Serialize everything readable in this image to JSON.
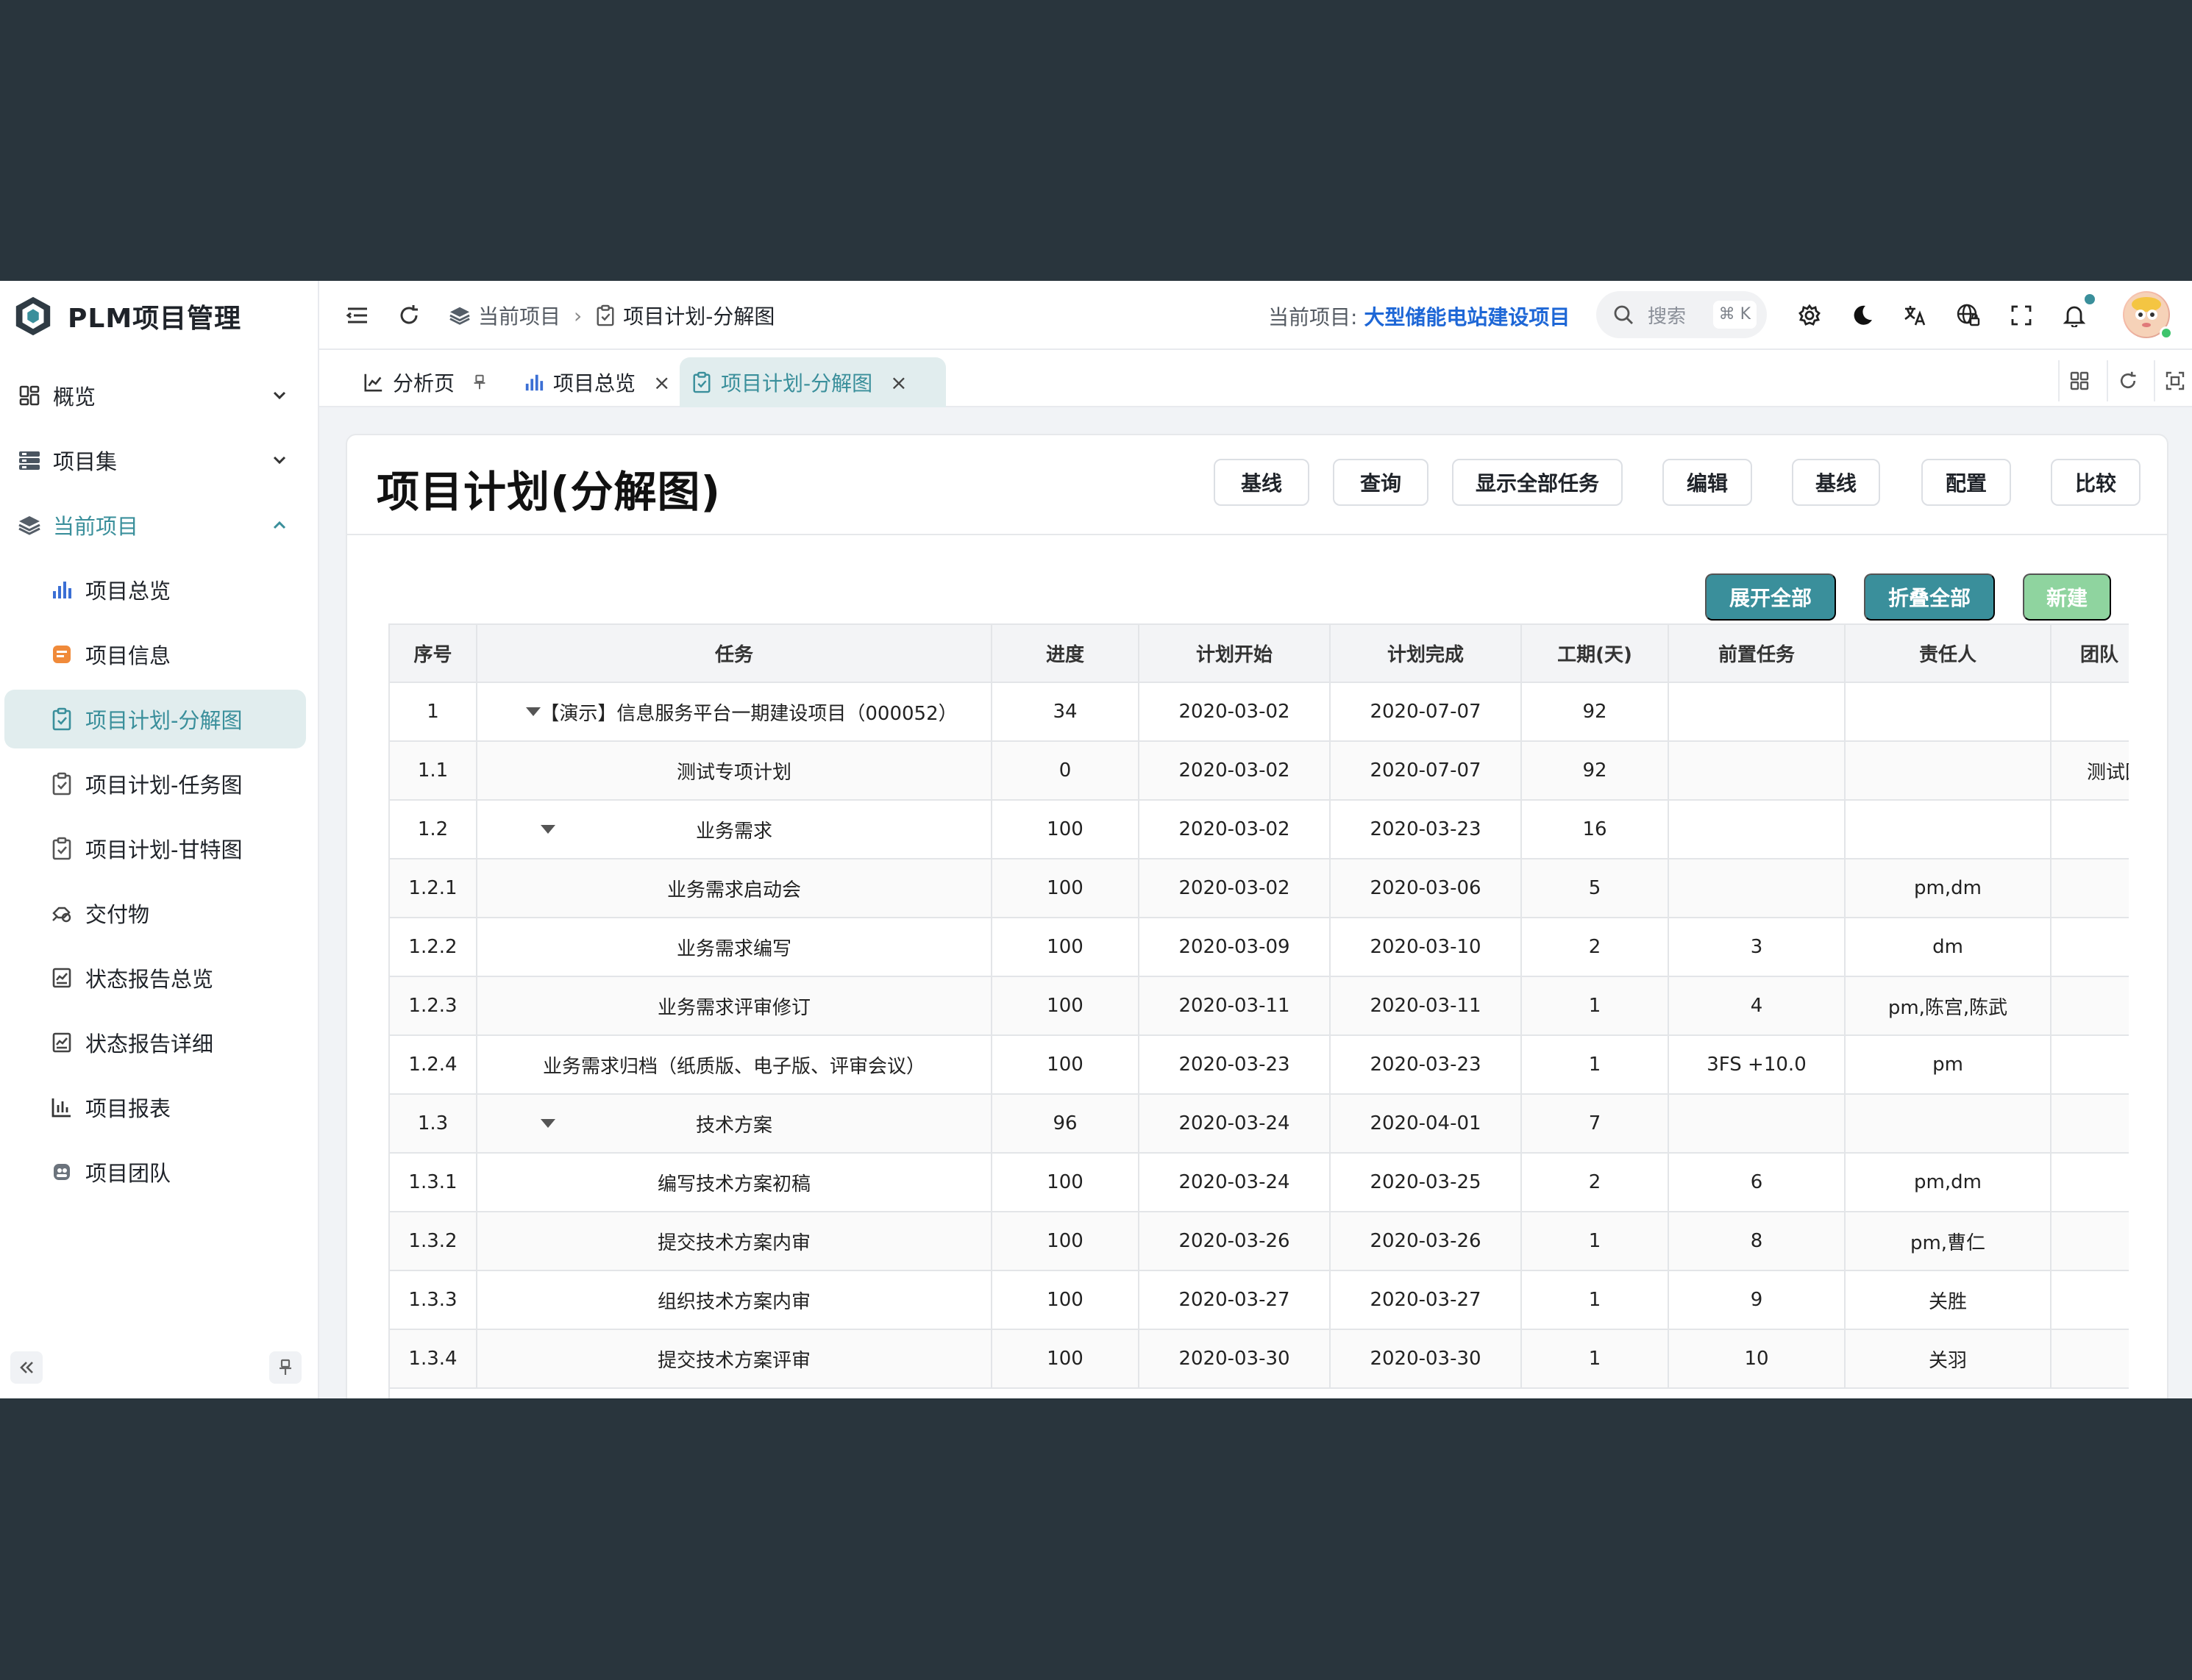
{
  "app": {
    "title": "PLM项目管理"
  },
  "sidebar": {
    "items": [
      {
        "label": "概览"
      },
      {
        "label": "项目集"
      },
      {
        "label": "当前项目"
      },
      {
        "label": "项目总览"
      },
      {
        "label": "项目信息"
      },
      {
        "label": "项目计划-分解图"
      },
      {
        "label": "项目计划-任务图"
      },
      {
        "label": "项目计划-甘特图"
      },
      {
        "label": "交付物"
      },
      {
        "label": "状态报告总览"
      },
      {
        "label": "状态报告详细"
      },
      {
        "label": "项目报表"
      },
      {
        "label": "项目团队"
      }
    ]
  },
  "header": {
    "breadcrumb": [
      "当前项目",
      "项目计划-分解图"
    ],
    "current_project_label": "当前项目:",
    "current_project_name": "大型储能电站建设项目",
    "search_placeholder": "搜索",
    "search_shortcut": "⌘ K"
  },
  "tabs": [
    {
      "label": "分析页"
    },
    {
      "label": "项目总览"
    },
    {
      "label": "项目计划-分解图"
    }
  ],
  "page": {
    "title": "项目计划(分解图)",
    "header_buttons": [
      "基线",
      "查询",
      "显示全部任务",
      "编辑",
      "基线",
      "配置",
      "比较"
    ],
    "actions": {
      "expand_all": "展开全部",
      "collapse_all": "折叠全部",
      "new": "新建"
    }
  },
  "table": {
    "columns": [
      "序号",
      "任务",
      "进度",
      "计划开始",
      "计划完成",
      "工期(天)",
      "前置任务",
      "责任人",
      "团队"
    ],
    "rows": [
      {
        "no": "1",
        "task": "【演示】信息服务平台一期建设项目（000052）",
        "progress": "34",
        "start": "2020-03-02",
        "end": "2020-07-07",
        "days": "92",
        "pred": "",
        "owner": "",
        "team": ""
      },
      {
        "no": "1.1",
        "task": "测试专项计划",
        "progress": "0",
        "start": "2020-03-02",
        "end": "2020-07-07",
        "days": "92",
        "pred": "",
        "owner": "",
        "team": "测试团"
      },
      {
        "no": "1.2",
        "task": "业务需求",
        "progress": "100",
        "start": "2020-03-02",
        "end": "2020-03-23",
        "days": "16",
        "pred": "",
        "owner": "",
        "team": ""
      },
      {
        "no": "1.2.1",
        "task": "业务需求启动会",
        "progress": "100",
        "start": "2020-03-02",
        "end": "2020-03-06",
        "days": "5",
        "pred": "",
        "owner": "pm,dm",
        "team": ""
      },
      {
        "no": "1.2.2",
        "task": "业务需求编写",
        "progress": "100",
        "start": "2020-03-09",
        "end": "2020-03-10",
        "days": "2",
        "pred": "3",
        "owner": "dm",
        "team": ""
      },
      {
        "no": "1.2.3",
        "task": "业务需求评审修订",
        "progress": "100",
        "start": "2020-03-11",
        "end": "2020-03-11",
        "days": "1",
        "pred": "4",
        "owner": "pm,陈宫,陈武",
        "team": ""
      },
      {
        "no": "1.2.4",
        "task": "业务需求归档（纸质版、电子版、评审会议）",
        "progress": "100",
        "start": "2020-03-23",
        "end": "2020-03-23",
        "days": "1",
        "pred": "3FS +10.0",
        "owner": "pm",
        "team": ""
      },
      {
        "no": "1.3",
        "task": "技术方案",
        "progress": "96",
        "start": "2020-03-24",
        "end": "2020-04-01",
        "days": "7",
        "pred": "",
        "owner": "",
        "team": ""
      },
      {
        "no": "1.3.1",
        "task": "编写技术方案初稿",
        "progress": "100",
        "start": "2020-03-24",
        "end": "2020-03-25",
        "days": "2",
        "pred": "6",
        "owner": "pm,dm",
        "team": ""
      },
      {
        "no": "1.3.2",
        "task": "提交技术方案内审",
        "progress": "100",
        "start": "2020-03-26",
        "end": "2020-03-26",
        "days": "1",
        "pred": "8",
        "owner": "pm,曹仁",
        "team": ""
      },
      {
        "no": "1.3.3",
        "task": "组织技术方案内审",
        "progress": "100",
        "start": "2020-03-27",
        "end": "2020-03-27",
        "days": "1",
        "pred": "9",
        "owner": "关胜",
        "team": ""
      },
      {
        "no": "1.3.4",
        "task": "提交技术方案评审",
        "progress": "100",
        "start": "2020-03-30",
        "end": "2020-03-30",
        "days": "1",
        "pred": "10",
        "owner": "关羽",
        "team": ""
      }
    ]
  },
  "colors": {
    "accent": "#3a8f9b",
    "accent_light": "#e1edee",
    "link_blue": "#1e67d6",
    "new_button": "#8fd49f",
    "backdrop": "#29353d"
  }
}
